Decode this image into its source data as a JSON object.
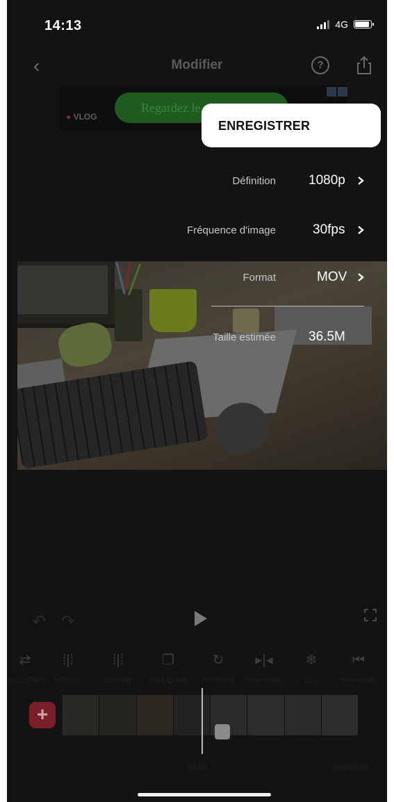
{
  "status_bar": {
    "time": "14:13",
    "network": "4G",
    "signal_bars": 3,
    "battery_level": 0.9
  },
  "nav": {
    "title": "Modifier",
    "back_icon": "chevron-left-icon",
    "help_icon": "question-circle-icon",
    "share_icon": "share-icon"
  },
  "ad": {
    "logo": "VLOG",
    "cta": "Regardez le"
  },
  "export": {
    "save_label": "ENREGISTRER",
    "rows": [
      {
        "label": "Définition",
        "value": "1080p"
      },
      {
        "label": "Fréquence d'image",
        "value": "30fps"
      },
      {
        "label": "Format",
        "value": "MOV"
      },
      {
        "label": "Taille estimée",
        "value": "36.5M"
      }
    ]
  },
  "tools": [
    {
      "icon": "⇄",
      "label": "ACCÉLÉRER"
    },
    {
      "icon": "⁞|⁞",
      "label": "VITESSE"
    },
    {
      "icon": "⁞|⁞",
      "label": "DIVISER"
    },
    {
      "icon": "❐",
      "label": "DUPLIQUER"
    },
    {
      "icon": "↻",
      "label": "ROTATION"
    },
    {
      "icon": "▸|◂",
      "label": "INVERSER"
    },
    {
      "icon": "❄",
      "label": "GEL"
    },
    {
      "icon": "⏮",
      "label": "INVERSER"
    }
  ],
  "timeline": {
    "current": "0:16.0",
    "total": "Total 0:18.0"
  },
  "colors": {
    "accent_add": "#7a1f2a",
    "popup_bg": "#ffffff",
    "background": "#131313"
  }
}
